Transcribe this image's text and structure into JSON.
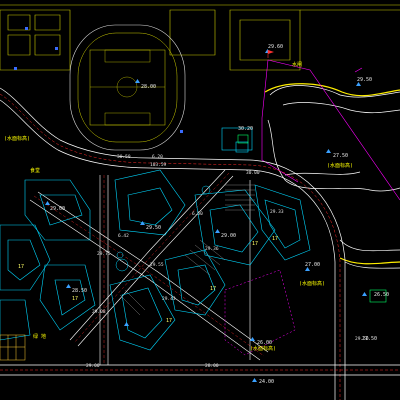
{
  "colors": {
    "background": "#000000",
    "road_edge": "#ffffff",
    "road_center": "#ff3030",
    "building": "#00e5ff",
    "annotation": "#ffff00",
    "boundary": "#ff00ff",
    "landscape": "#ffffff",
    "plot_green": "#00ff66",
    "marker_blue": "#3aa0ff",
    "parking": "#ffcc33"
  },
  "icons": [
    "elevation-marker-icon",
    "tree-symbol-icon",
    "pin-flag-icon"
  ],
  "elevations": [
    {
      "id": "track-center",
      "text": "28.00"
    },
    {
      "id": "north-pin",
      "text": "29.60"
    },
    {
      "id": "lake-north",
      "text": "29.50"
    },
    {
      "id": "lake-center",
      "text": "27.50"
    },
    {
      "id": "east-pond",
      "text": "27.00"
    },
    {
      "id": "east-pond-2",
      "text": "26.50"
    },
    {
      "id": "gate",
      "text": "30.20"
    },
    {
      "id": "block-center-1",
      "text": "29.50"
    },
    {
      "id": "block-center-2",
      "text": "29.00"
    },
    {
      "id": "south-plaza",
      "text": "26.00"
    },
    {
      "id": "south-road",
      "text": "24.00"
    },
    {
      "id": "east-road",
      "text": "27.50"
    },
    {
      "id": "road-north-a",
      "text": "30.50"
    },
    {
      "id": "road-north-b",
      "text": "30.00"
    },
    {
      "id": "road-north-c",
      "text": "6.20"
    },
    {
      "id": "road-north-d",
      "text": "103.59"
    },
    {
      "id": "block-west",
      "text": "29.00"
    },
    {
      "id": "block-sw",
      "text": "28.50"
    },
    {
      "id": "road-south-a",
      "text": "29.00"
    },
    {
      "id": "road-south-b",
      "text": "28.00"
    }
  ],
  "grid_labels": [
    {
      "id": "g1",
      "text": "6.42"
    },
    {
      "id": "g2",
      "text": "6.50"
    },
    {
      "id": "g3",
      "text": "29.55"
    },
    {
      "id": "g4",
      "text": "29.43"
    },
    {
      "id": "g5",
      "text": "29.50"
    },
    {
      "id": "g6",
      "text": "29.75"
    },
    {
      "id": "g7",
      "text": "29.08"
    },
    {
      "id": "g8",
      "text": "29.33"
    },
    {
      "id": "g9",
      "text": "29.36"
    }
  ],
  "floors": [
    {
      "id": "f1",
      "text": "17"
    },
    {
      "id": "f2",
      "text": "17"
    },
    {
      "id": "f3",
      "text": "17"
    },
    {
      "id": "f4",
      "text": "17"
    },
    {
      "id": "f5",
      "text": "17"
    },
    {
      "id": "f6",
      "text": "17"
    }
  ],
  "annotations": [
    {
      "id": "lake-tag",
      "text": "(水面标高)"
    },
    {
      "id": "pond-tag",
      "text": "(水面标高)"
    },
    {
      "id": "plaza-tag",
      "text": "(水面标高)"
    },
    {
      "id": "west-tag",
      "text": "(水面标高)"
    },
    {
      "id": "pin-tag",
      "text": "水闸"
    },
    {
      "id": "zone-tag",
      "text": "绿 地"
    },
    {
      "id": "hall-tag",
      "text": "食堂"
    }
  ]
}
